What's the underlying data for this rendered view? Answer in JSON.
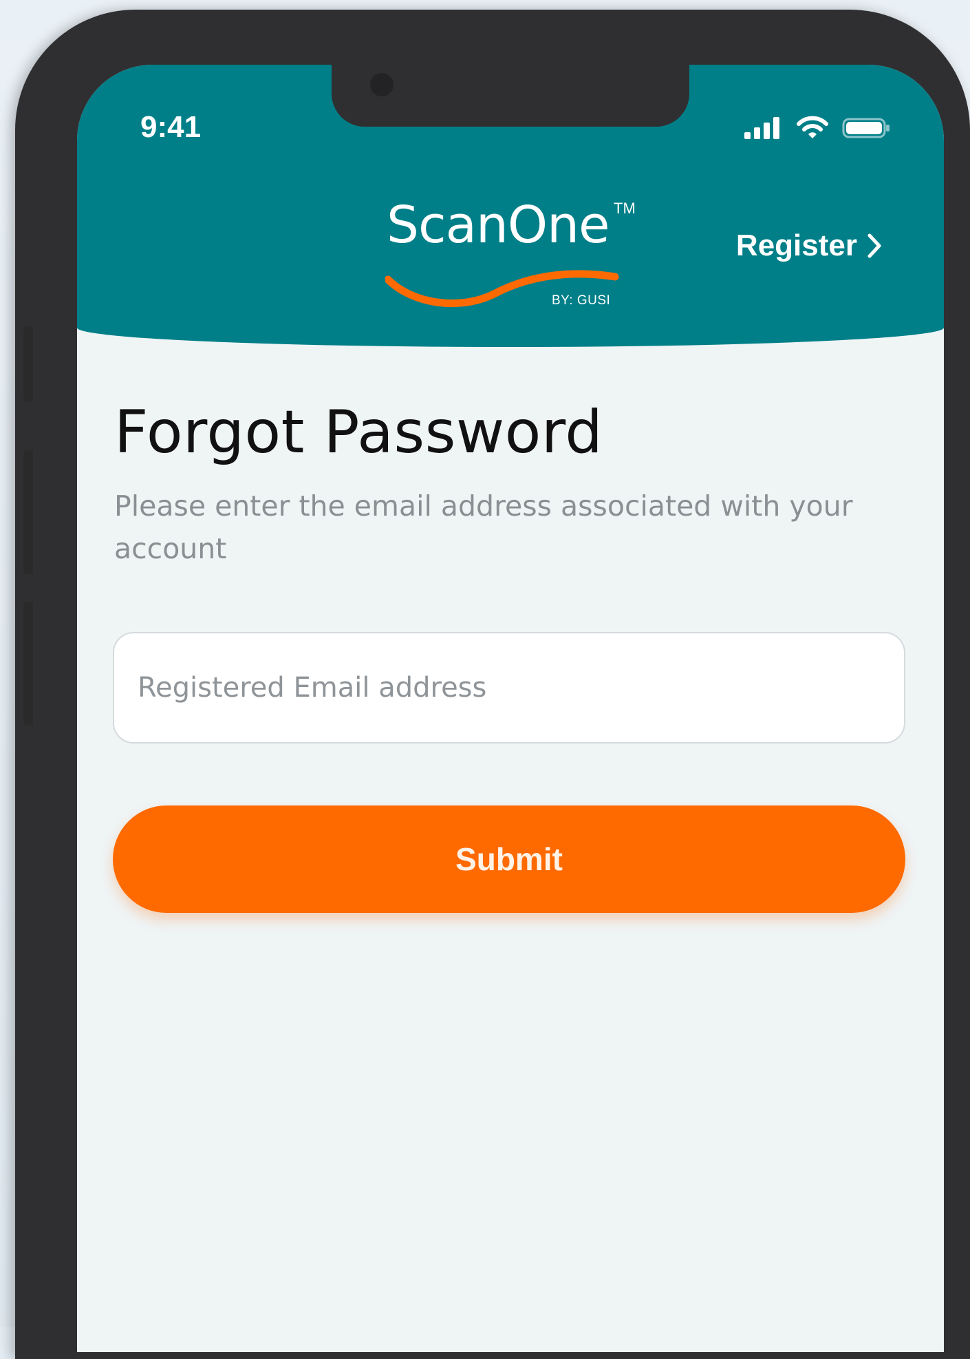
{
  "status_bar": {
    "time": "9:41",
    "icons": [
      "cellular-signal-icon",
      "wifi-icon",
      "battery-icon"
    ]
  },
  "header": {
    "logo": {
      "name": "ScanOne",
      "trademark": "TM",
      "tagline": "BY: GUSI"
    },
    "register_label": "Register",
    "register_icon": "chevron-right-icon"
  },
  "main": {
    "title": "Forgot Password",
    "subtitle": "Please enter the email address associated with your account",
    "email_input": {
      "placeholder": "Registered Email address",
      "value": ""
    },
    "submit_label": "Submit"
  },
  "colors": {
    "header_teal": "#007f88",
    "accent_orange": "#fe6a00",
    "background": "#eff4f5"
  }
}
